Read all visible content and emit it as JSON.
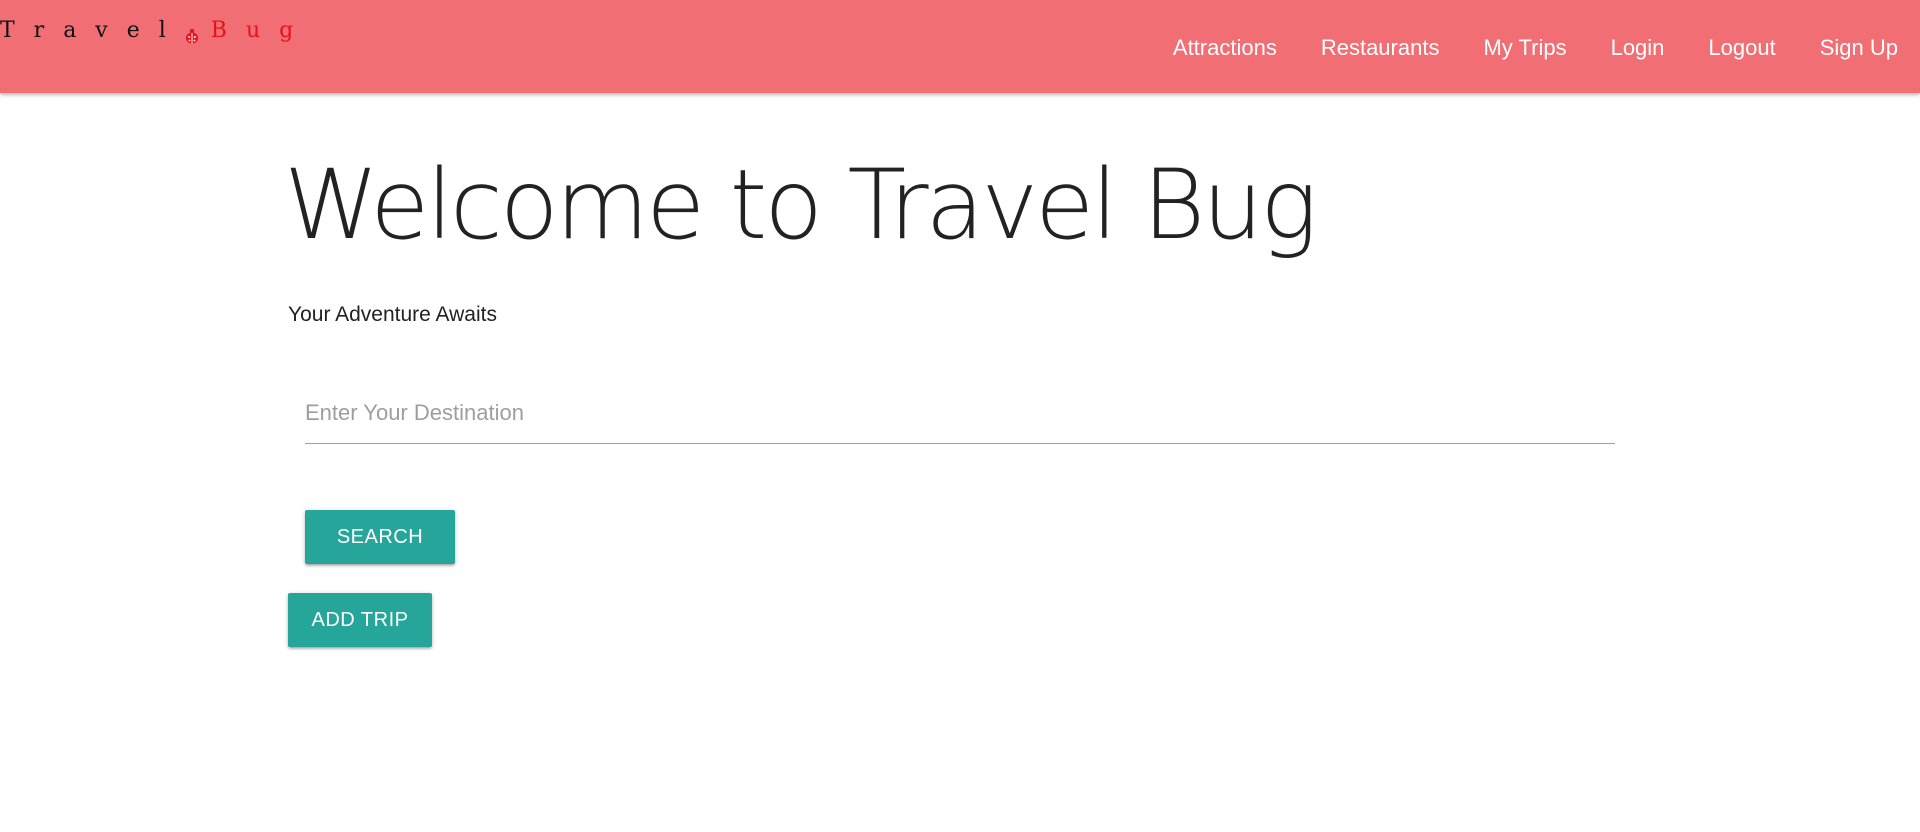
{
  "navbar": {
    "brand": {
      "word_travel": "Travel",
      "word_bug": "Bug"
    },
    "links": [
      {
        "label": "Attractions"
      },
      {
        "label": "Restaurants"
      },
      {
        "label": "My Trips"
      },
      {
        "label": "Login"
      },
      {
        "label": "Logout"
      },
      {
        "label": "Sign Up"
      }
    ]
  },
  "hero": {
    "title": "Welcome to Travel Bug",
    "tagline": "Your Adventure Awaits"
  },
  "search": {
    "value": "",
    "placeholder": "Enter Your Destination",
    "button_label": "Search"
  },
  "add_trip": {
    "button_label": "Add Trip"
  },
  "colors": {
    "navbar_bg": "#f06e74",
    "brand_red": "#e8121a",
    "button_teal": "#26a69a"
  },
  "icons": {
    "brand_icon": "ladybug-icon"
  }
}
